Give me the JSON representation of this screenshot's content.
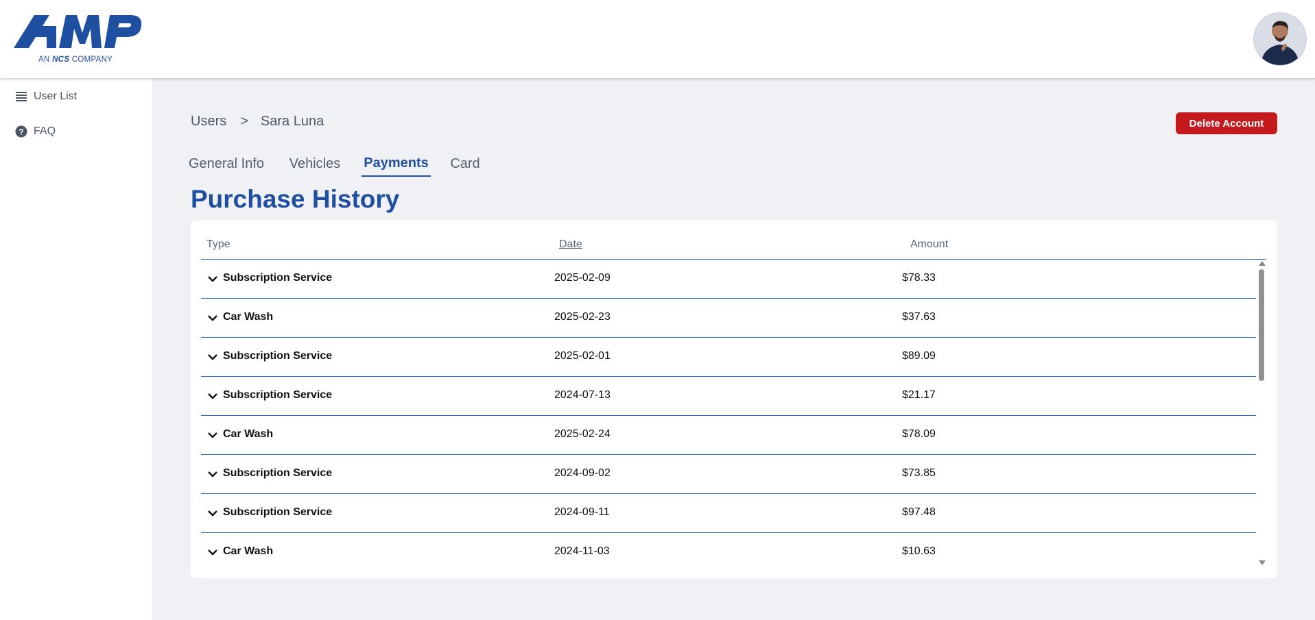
{
  "app": {
    "logo_text": "AMP",
    "logo_sub_prefix": "AN ",
    "logo_sub_brand": "NCS",
    "logo_sub_suffix": " COMPANY",
    "brand_color": "#1f4fa0",
    "avatar_icon": "user-avatar"
  },
  "sidebar": {
    "items": [
      {
        "label": "User List",
        "icon": "list-icon"
      },
      {
        "label": "FAQ",
        "icon": "help-icon"
      }
    ]
  },
  "breadcrumb": {
    "root": "Users",
    "separator": ">",
    "current": "Sara Luna"
  },
  "actions": {
    "delete_label": "Delete Account",
    "delete_color": "#c41a1e"
  },
  "tabs": [
    {
      "label": "General Info",
      "active": false
    },
    {
      "label": "Vehicles",
      "active": false
    },
    {
      "label": "Payments",
      "active": true
    },
    {
      "label": "Card",
      "active": false
    }
  ],
  "purchase_history": {
    "title": "Purchase History",
    "columns": [
      "Type",
      "Date",
      "Amount"
    ],
    "rows": [
      {
        "type": "Subscription Service",
        "date": "2025-02-09",
        "amount": "$78.33"
      },
      {
        "type": "Car Wash",
        "date": "2025-02-23",
        "amount": "$37.63"
      },
      {
        "type": "Subscription Service",
        "date": "2025-02-01",
        "amount": "$89.09"
      },
      {
        "type": "Subscription Service",
        "date": "2024-07-13",
        "amount": "$21.17"
      },
      {
        "type": "Car Wash",
        "date": "2025-02-24",
        "amount": "$78.09"
      },
      {
        "type": "Subscription Service",
        "date": "2024-09-02",
        "amount": "$73.85"
      },
      {
        "type": "Subscription Service",
        "date": "2024-09-11",
        "amount": "$97.48"
      },
      {
        "type": "Car Wash",
        "date": "2024-11-03",
        "amount": "$10.63"
      }
    ]
  }
}
